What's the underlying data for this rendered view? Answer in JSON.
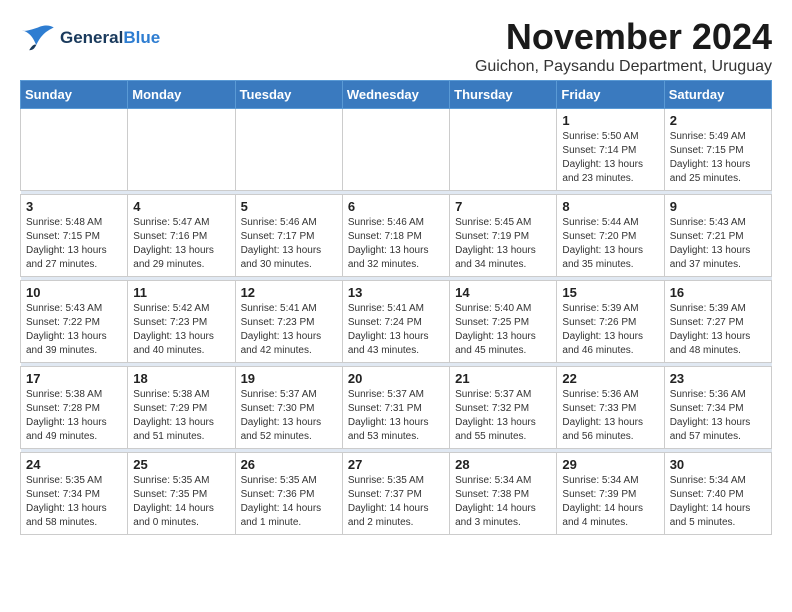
{
  "logo": {
    "line1": "General",
    "line2": "Blue"
  },
  "header": {
    "month": "November 2024",
    "location": "Guichon, Paysandu Department, Uruguay"
  },
  "weekdays": [
    "Sunday",
    "Monday",
    "Tuesday",
    "Wednesday",
    "Thursday",
    "Friday",
    "Saturday"
  ],
  "weeks": [
    [
      {
        "day": "",
        "info": ""
      },
      {
        "day": "",
        "info": ""
      },
      {
        "day": "",
        "info": ""
      },
      {
        "day": "",
        "info": ""
      },
      {
        "day": "",
        "info": ""
      },
      {
        "day": "1",
        "info": "Sunrise: 5:50 AM\nSunset: 7:14 PM\nDaylight: 13 hours\nand 23 minutes."
      },
      {
        "day": "2",
        "info": "Sunrise: 5:49 AM\nSunset: 7:15 PM\nDaylight: 13 hours\nand 25 minutes."
      }
    ],
    [
      {
        "day": "3",
        "info": "Sunrise: 5:48 AM\nSunset: 7:15 PM\nDaylight: 13 hours\nand 27 minutes."
      },
      {
        "day": "4",
        "info": "Sunrise: 5:47 AM\nSunset: 7:16 PM\nDaylight: 13 hours\nand 29 minutes."
      },
      {
        "day": "5",
        "info": "Sunrise: 5:46 AM\nSunset: 7:17 PM\nDaylight: 13 hours\nand 30 minutes."
      },
      {
        "day": "6",
        "info": "Sunrise: 5:46 AM\nSunset: 7:18 PM\nDaylight: 13 hours\nand 32 minutes."
      },
      {
        "day": "7",
        "info": "Sunrise: 5:45 AM\nSunset: 7:19 PM\nDaylight: 13 hours\nand 34 minutes."
      },
      {
        "day": "8",
        "info": "Sunrise: 5:44 AM\nSunset: 7:20 PM\nDaylight: 13 hours\nand 35 minutes."
      },
      {
        "day": "9",
        "info": "Sunrise: 5:43 AM\nSunset: 7:21 PM\nDaylight: 13 hours\nand 37 minutes."
      }
    ],
    [
      {
        "day": "10",
        "info": "Sunrise: 5:43 AM\nSunset: 7:22 PM\nDaylight: 13 hours\nand 39 minutes."
      },
      {
        "day": "11",
        "info": "Sunrise: 5:42 AM\nSunset: 7:23 PM\nDaylight: 13 hours\nand 40 minutes."
      },
      {
        "day": "12",
        "info": "Sunrise: 5:41 AM\nSunset: 7:23 PM\nDaylight: 13 hours\nand 42 minutes."
      },
      {
        "day": "13",
        "info": "Sunrise: 5:41 AM\nSunset: 7:24 PM\nDaylight: 13 hours\nand 43 minutes."
      },
      {
        "day": "14",
        "info": "Sunrise: 5:40 AM\nSunset: 7:25 PM\nDaylight: 13 hours\nand 45 minutes."
      },
      {
        "day": "15",
        "info": "Sunrise: 5:39 AM\nSunset: 7:26 PM\nDaylight: 13 hours\nand 46 minutes."
      },
      {
        "day": "16",
        "info": "Sunrise: 5:39 AM\nSunset: 7:27 PM\nDaylight: 13 hours\nand 48 minutes."
      }
    ],
    [
      {
        "day": "17",
        "info": "Sunrise: 5:38 AM\nSunset: 7:28 PM\nDaylight: 13 hours\nand 49 minutes."
      },
      {
        "day": "18",
        "info": "Sunrise: 5:38 AM\nSunset: 7:29 PM\nDaylight: 13 hours\nand 51 minutes."
      },
      {
        "day": "19",
        "info": "Sunrise: 5:37 AM\nSunset: 7:30 PM\nDaylight: 13 hours\nand 52 minutes."
      },
      {
        "day": "20",
        "info": "Sunrise: 5:37 AM\nSunset: 7:31 PM\nDaylight: 13 hours\nand 53 minutes."
      },
      {
        "day": "21",
        "info": "Sunrise: 5:37 AM\nSunset: 7:32 PM\nDaylight: 13 hours\nand 55 minutes."
      },
      {
        "day": "22",
        "info": "Sunrise: 5:36 AM\nSunset: 7:33 PM\nDaylight: 13 hours\nand 56 minutes."
      },
      {
        "day": "23",
        "info": "Sunrise: 5:36 AM\nSunset: 7:34 PM\nDaylight: 13 hours\nand 57 minutes."
      }
    ],
    [
      {
        "day": "24",
        "info": "Sunrise: 5:35 AM\nSunset: 7:34 PM\nDaylight: 13 hours\nand 58 minutes."
      },
      {
        "day": "25",
        "info": "Sunrise: 5:35 AM\nSunset: 7:35 PM\nDaylight: 14 hours\nand 0 minutes."
      },
      {
        "day": "26",
        "info": "Sunrise: 5:35 AM\nSunset: 7:36 PM\nDaylight: 14 hours\nand 1 minute."
      },
      {
        "day": "27",
        "info": "Sunrise: 5:35 AM\nSunset: 7:37 PM\nDaylight: 14 hours\nand 2 minutes."
      },
      {
        "day": "28",
        "info": "Sunrise: 5:34 AM\nSunset: 7:38 PM\nDaylight: 14 hours\nand 3 minutes."
      },
      {
        "day": "29",
        "info": "Sunrise: 5:34 AM\nSunset: 7:39 PM\nDaylight: 14 hours\nand 4 minutes."
      },
      {
        "day": "30",
        "info": "Sunrise: 5:34 AM\nSunset: 7:40 PM\nDaylight: 14 hours\nand 5 minutes."
      }
    ]
  ]
}
